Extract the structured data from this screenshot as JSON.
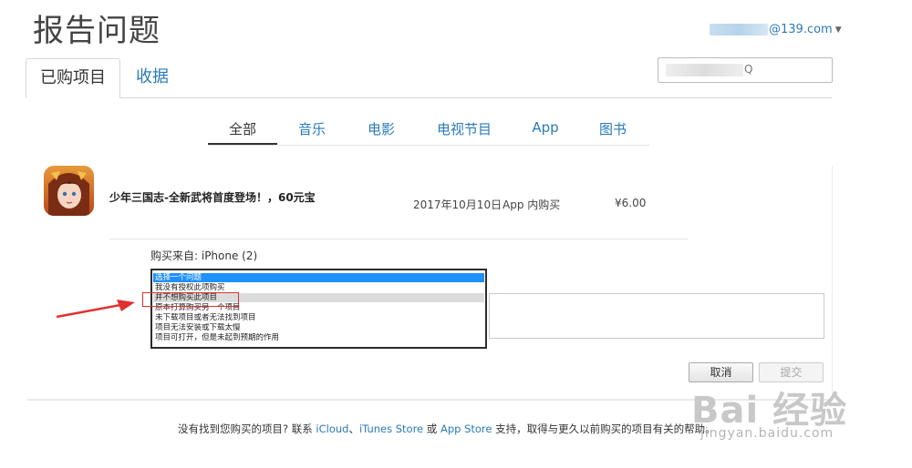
{
  "header": {
    "title": "报告问题",
    "account": "@139.com",
    "search_suffix": "Q"
  },
  "tabs": [
    {
      "label": "已购项目"
    },
    {
      "label": "收据"
    }
  ],
  "categories": [
    {
      "label": "全部"
    },
    {
      "label": "音乐"
    },
    {
      "label": "电影"
    },
    {
      "label": "电视节目"
    },
    {
      "label": "App"
    },
    {
      "label": "图书"
    }
  ],
  "item": {
    "name": "少年三国志-全新武将首度登场！，60元宝",
    "date": "2017年10月10日",
    "type": "App 内购买",
    "price": "¥6.00"
  },
  "form": {
    "source": "购买来自: iPhone (2)",
    "options": [
      "选择一个问题",
      "我没有授权此项购买",
      "并不想购买此项目",
      "原本打算购买另一个项目",
      "未下载项目或者无法找到项目",
      "项目无法安装或下载太慢",
      "项目可打开，但是未起到预期的作用"
    ],
    "cancel_label": "取消",
    "submit_label": "提交"
  },
  "footer": {
    "text1": "没有找到您购买的项目? 联系 ",
    "link_icloud": "iCloud",
    "sep1": "、",
    "link_itunes": "iTunes Store",
    "sep2": " 或 ",
    "link_appstore": "App Store",
    "text2": " 支持，取得与更久以前购买的项目有关的帮助。"
  },
  "watermark": {
    "text": "Bai  经验",
    "url": "jingyan.baidu.com"
  },
  "colors": {
    "link": "#2a7ab8",
    "selected_option": "#1e90ff",
    "annotation": "#e03131"
  }
}
